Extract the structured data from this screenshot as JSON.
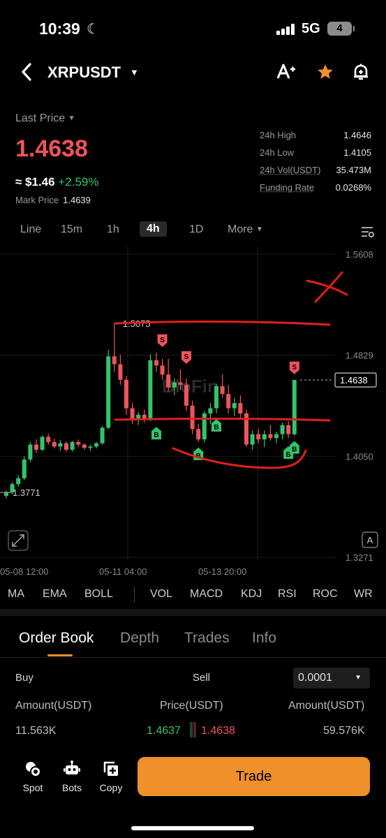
{
  "status": {
    "time": "10:39",
    "network": "5G",
    "battery": "4"
  },
  "header": {
    "symbol": "XRPUSDT"
  },
  "price": {
    "last_label": "Last Price",
    "last": "1.4638",
    "approx": "≈ $1.46",
    "change": "+2.59%",
    "mark_label": "Mark Price",
    "mark": "1.4639"
  },
  "stats": [
    {
      "k": "24h High",
      "v": "1.4646"
    },
    {
      "k": "24h Low",
      "v": "1.4105"
    },
    {
      "k": "24h Vol(USDT)",
      "v": "35.473M"
    },
    {
      "k": "Funding Rate",
      "v": "0.0268%"
    }
  ],
  "timeframes": [
    "Line",
    "15m",
    "1h",
    "4h",
    "1D",
    "More"
  ],
  "active_timeframe": "4h",
  "chart_data": {
    "type": "candlestick",
    "y_ticks": [
      "1.5608",
      "1.4829",
      "1.4050",
      "1.3271"
    ],
    "ylim": [
      1.3271,
      1.5608
    ],
    "x_ticks": [
      "05-08 12:00",
      "05-11 04:00",
      "05-13 20:00"
    ],
    "high_label": "1.5075",
    "low_label": "1.3771",
    "current_label": "1.4638",
    "markers": {
      "buy": "B",
      "sell": "S"
    },
    "candles": [
      [
        1.3745,
        1.3786,
        1.3725,
        1.3771
      ],
      [
        1.3771,
        1.385,
        1.3755,
        1.3835
      ],
      [
        1.3835,
        1.3905,
        1.3815,
        1.388
      ],
      [
        1.388,
        1.405,
        1.3865,
        1.4025
      ],
      [
        1.4025,
        1.416,
        1.4005,
        1.414
      ],
      [
        1.414,
        1.418,
        1.4075,
        1.41
      ],
      [
        1.41,
        1.421,
        1.409,
        1.42
      ],
      [
        1.42,
        1.4225,
        1.414,
        1.416
      ],
      [
        1.416,
        1.4185,
        1.411,
        1.4125
      ],
      [
        1.4125,
        1.4175,
        1.409,
        1.415
      ],
      [
        1.415,
        1.4165,
        1.4085,
        1.41
      ],
      [
        1.41,
        1.417,
        1.4085,
        1.416
      ],
      [
        1.416,
        1.418,
        1.412,
        1.414
      ],
      [
        1.414,
        1.415,
        1.41,
        1.4115
      ],
      [
        1.4115,
        1.414,
        1.409,
        1.4125
      ],
      [
        1.4125,
        1.416,
        1.411,
        1.415
      ],
      [
        1.415,
        1.428,
        1.414,
        1.427
      ],
      [
        1.427,
        1.487,
        1.426,
        1.482
      ],
      [
        1.482,
        1.5075,
        1.47,
        1.476
      ],
      [
        1.476,
        1.483,
        1.46,
        1.464
      ],
      [
        1.464,
        1.467,
        1.437,
        1.442
      ],
      [
        1.442,
        1.446,
        1.43,
        1.434
      ],
      [
        1.434,
        1.439,
        1.429,
        1.437
      ],
      [
        1.437,
        1.441,
        1.431,
        1.433
      ],
      [
        1.433,
        1.4835,
        1.432,
        1.479
      ],
      [
        1.479,
        1.485,
        1.47,
        1.475
      ],
      [
        1.475,
        1.48,
        1.464,
        1.468
      ],
      [
        1.468,
        1.48,
        1.455,
        1.458
      ],
      [
        1.458,
        1.465,
        1.452,
        1.462
      ],
      [
        1.462,
        1.472,
        1.456,
        1.46
      ],
      [
        1.46,
        1.465,
        1.44,
        1.444
      ],
      [
        1.444,
        1.448,
        1.422,
        1.426
      ],
      [
        1.426,
        1.43,
        1.416,
        1.418
      ],
      [
        1.418,
        1.44,
        1.416,
        1.438
      ],
      [
        1.438,
        1.446,
        1.43,
        1.442
      ],
      [
        1.442,
        1.461,
        1.438,
        1.459
      ],
      [
        1.459,
        1.468,
        1.45,
        1.453
      ],
      [
        1.453,
        1.46,
        1.438,
        1.442
      ],
      [
        1.442,
        1.45,
        1.436,
        1.446
      ],
      [
        1.446,
        1.452,
        1.434,
        1.438
      ],
      [
        1.438,
        1.441,
        1.412,
        1.414
      ],
      [
        1.414,
        1.425,
        1.41,
        1.422
      ],
      [
        1.422,
        1.426,
        1.415,
        1.418
      ],
      [
        1.418,
        1.425,
        1.412,
        1.422
      ],
      [
        1.422,
        1.429,
        1.417,
        1.419
      ],
      [
        1.419,
        1.424,
        1.415,
        1.422
      ],
      [
        1.422,
        1.431,
        1.418,
        1.429
      ],
      [
        1.429,
        1.432,
        1.419,
        1.422
      ],
      [
        1.422,
        1.464,
        1.421,
        1.4638
      ]
    ]
  },
  "indicators": [
    "MA",
    "EMA",
    "BOLL",
    "VOL",
    "MACD",
    "KDJ",
    "RSI",
    "ROC",
    "WR"
  ],
  "orderbook": {
    "tabs": [
      "Order Book",
      "Depth",
      "Trades",
      "Info"
    ],
    "buy_label": "Buy",
    "sell_label": "Sell",
    "precision": "0.0001",
    "headers": {
      "left": "Amount(USDT)",
      "mid": "Price(USDT)",
      "right": "Amount(USDT)"
    },
    "row": {
      "buy_amount": "11.563K",
      "bid": "1.4637",
      "ask": "1.4638",
      "sell_amount": "59.576K"
    }
  },
  "bottom": {
    "spot": "Spot",
    "bots": "Bots",
    "copy": "Copy",
    "trade": "Trade"
  },
  "colors": {
    "up": "#34c36b",
    "down": "#f0545c",
    "accent": "#f0902a",
    "annotation": "#e0201a"
  }
}
